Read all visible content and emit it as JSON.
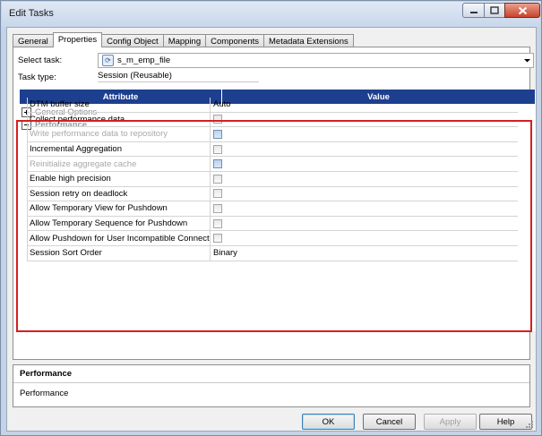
{
  "window": {
    "title": "Edit Tasks"
  },
  "tabs": [
    {
      "label": "General",
      "active": false
    },
    {
      "label": "Properties",
      "active": true
    },
    {
      "label": "Config Object",
      "active": false
    },
    {
      "label": "Mapping",
      "active": false
    },
    {
      "label": "Components",
      "active": false
    },
    {
      "label": "Metadata Extensions",
      "active": false
    }
  ],
  "task": {
    "select_label": "Select task:",
    "selected": "s_m_emp_file",
    "type_label": "Task type:",
    "type_value": "Session (Reusable)"
  },
  "grid": {
    "col_attribute": "Attribute",
    "col_value": "Value",
    "groups": {
      "general": "General Options",
      "performance": "Performance"
    },
    "rows": [
      {
        "attribute": "DTM buffer size",
        "value": "Auto",
        "kind": "text",
        "disabled": false
      },
      {
        "attribute": "Collect performance data",
        "kind": "checkbox",
        "checked": false,
        "disabled": false
      },
      {
        "attribute": "Write performance data to repository",
        "kind": "checkbox",
        "checked": false,
        "disabled": true
      },
      {
        "attribute": "Incremental Aggregation",
        "kind": "checkbox",
        "checked": false,
        "disabled": false
      },
      {
        "attribute": "Reinitialize aggregate cache",
        "kind": "checkbox",
        "checked": false,
        "disabled": true
      },
      {
        "attribute": "Enable high precision",
        "kind": "checkbox",
        "checked": false,
        "disabled": false
      },
      {
        "attribute": "Session retry on deadlock",
        "kind": "checkbox",
        "checked": false,
        "disabled": false
      },
      {
        "attribute": "Allow Temporary View for Pushdown",
        "kind": "checkbox",
        "checked": false,
        "disabled": false
      },
      {
        "attribute": "Allow Temporary Sequence for Pushdown",
        "kind": "checkbox",
        "checked": false,
        "disabled": false
      },
      {
        "attribute": "Allow Pushdown for User Incompatible Connecti...",
        "kind": "checkbox",
        "checked": false,
        "disabled": false
      },
      {
        "attribute": "Session Sort Order",
        "value": "Binary",
        "kind": "text",
        "disabled": false
      }
    ]
  },
  "description": {
    "title": "Performance",
    "text": "Performance"
  },
  "buttons": {
    "ok": "OK",
    "cancel": "Cancel",
    "apply": "Apply",
    "help": "Help"
  },
  "colors": {
    "grid_header": "#1d3f8f",
    "highlight_box": "#d42020"
  }
}
